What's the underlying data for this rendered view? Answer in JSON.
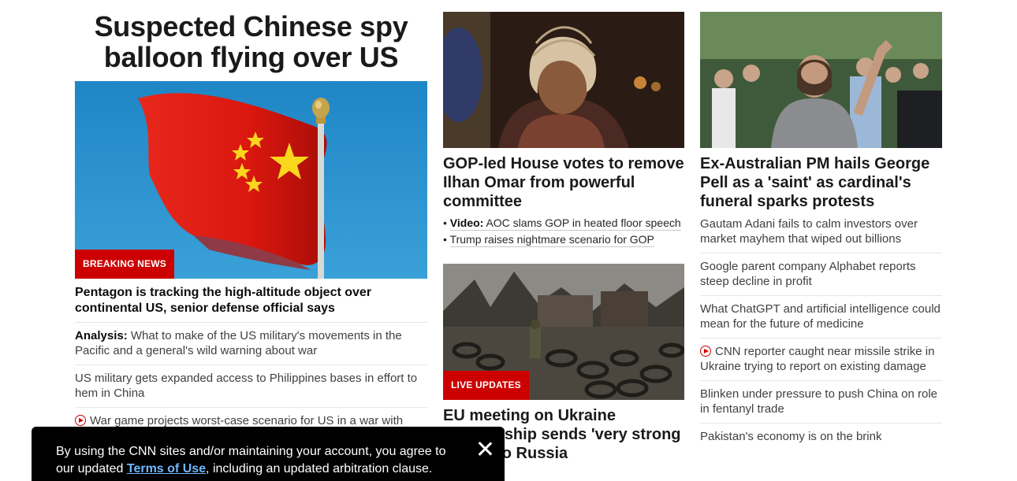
{
  "lead": {
    "headline": "Suspected Chinese spy balloon flying over US",
    "badge": "BREAKING NEWS",
    "title": "Pentagon is tracking the high-altitude object over continental US, senior defense official says",
    "stories": [
      {
        "prefix": "Analysis:",
        "text": "What to make of the US military's movements in the Pacific and a general's wild warning about war"
      },
      {
        "text": "US military gets expanded access to Philippines bases in effort to hem in China"
      },
      {
        "icon": "play-icon",
        "text": "War game projects worst-case scenario for US in a war with"
      }
    ]
  },
  "middle": {
    "story1": {
      "title": "GOP-led House votes to remove Ilhan Omar from powerful committee",
      "bullets": [
        {
          "prefix": "Video:",
          "text": "AOC slams GOP in heated floor speech"
        },
        {
          "text": "Trump raises nightmare scenario for GOP"
        }
      ]
    },
    "story2": {
      "badge": "LIVE UPDATES",
      "title": "EU meeting on Ukraine membership sends 'very strong signal' to Russia"
    }
  },
  "right": {
    "title": "Ex-Australian PM hails George Pell as a 'saint' as cardinal's funeral sparks protests",
    "stories": [
      {
        "text": "Gautam Adani fails to calm investors over market mayhem that wiped out billions"
      },
      {
        "text": "Google parent company Alphabet reports steep decline in profit"
      },
      {
        "text": "What ChatGPT and artificial intelligence could mean for the future of medicine"
      },
      {
        "icon": "play-icon",
        "text": "CNN reporter caught near missile strike in Ukraine trying to report on existing damage"
      },
      {
        "text": "Blinken under pressure to push China on role in fentanyl trade"
      },
      {
        "text": "Pakistan's economy is on the brink"
      }
    ]
  },
  "toast": {
    "text_before": "By using the CNN sites and/or maintaining your account, you agree to our updated ",
    "link": "Terms of Use",
    "text_after": ", including an updated arbitration clause."
  },
  "colors": {
    "accent_red": "#cc0000",
    "link_blue": "#6fb8ff"
  }
}
